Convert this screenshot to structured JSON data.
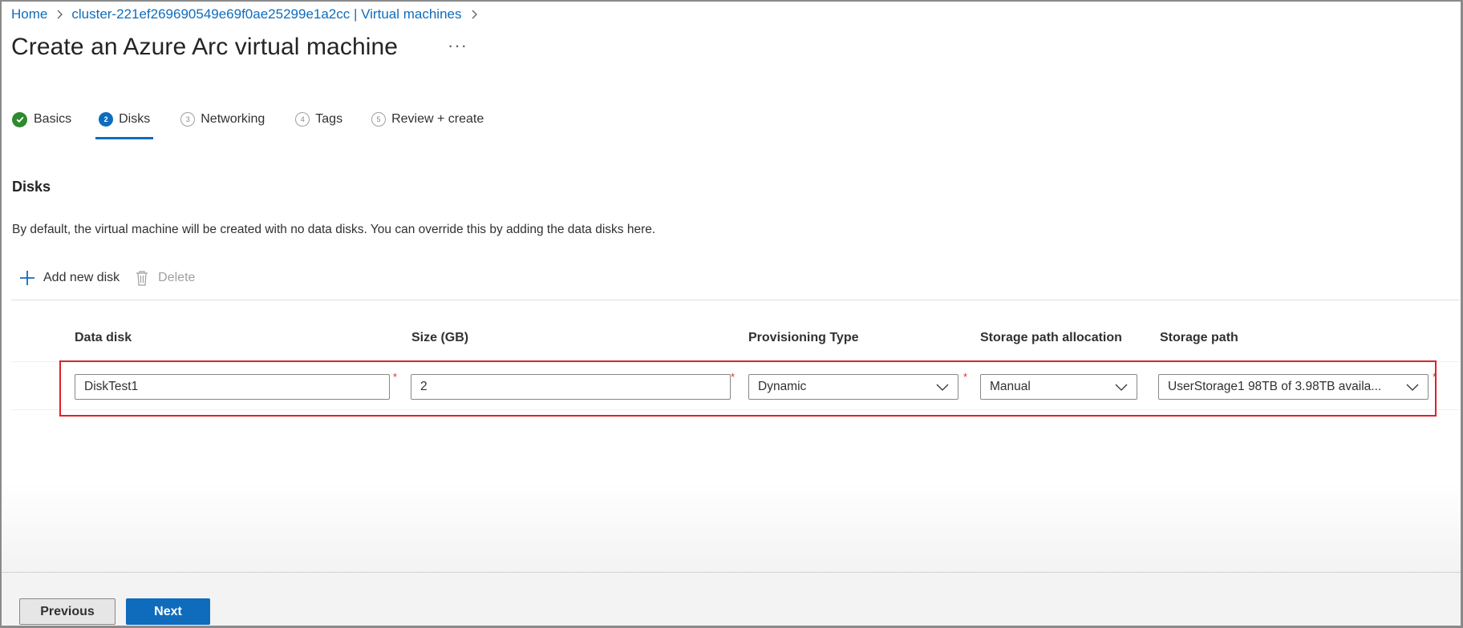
{
  "breadcrumb": {
    "items": [
      "Home",
      "cluster-221ef269690549e69f0ae25299e1a2cc | Virtual machines"
    ]
  },
  "page": {
    "title": "Create an Azure Arc virtual machine",
    "more_label": "···"
  },
  "tabs": [
    {
      "label": "Basics",
      "status": "completed"
    },
    {
      "label": "Disks",
      "number": "2",
      "status": "active"
    },
    {
      "label": "Networking",
      "number": "3"
    },
    {
      "label": "Tags",
      "number": "4"
    },
    {
      "label": "Review + create",
      "number": "5"
    }
  ],
  "section": {
    "title": "Disks",
    "description": "By default, the virtual machine will be created with no data disks. You can override this by adding the data disks here."
  },
  "toolbar": {
    "add_label": "Add new disk",
    "add_icon": "plus-icon",
    "delete_label": "Delete",
    "delete_icon": "trash-icon"
  },
  "table": {
    "columns": [
      "Data disk",
      "Size (GB)",
      "Provisioning Type",
      "Storage path allocation",
      "Storage path"
    ],
    "rows": [
      {
        "data_disk": "DiskTest1",
        "size_gb": "2",
        "provisioning_type": "Dynamic",
        "storage_path_allocation": "Manual",
        "storage_path": "UserStorage1 98TB of 3.98TB availa..."
      }
    ],
    "required_marker": "*"
  },
  "footer": {
    "previous_label": "Previous",
    "next_label": "Next"
  },
  "colors": {
    "accent": "#0f6cbd",
    "success": "#2e8a2e",
    "highlight_border": "#e0202a",
    "required": "#d13438"
  }
}
